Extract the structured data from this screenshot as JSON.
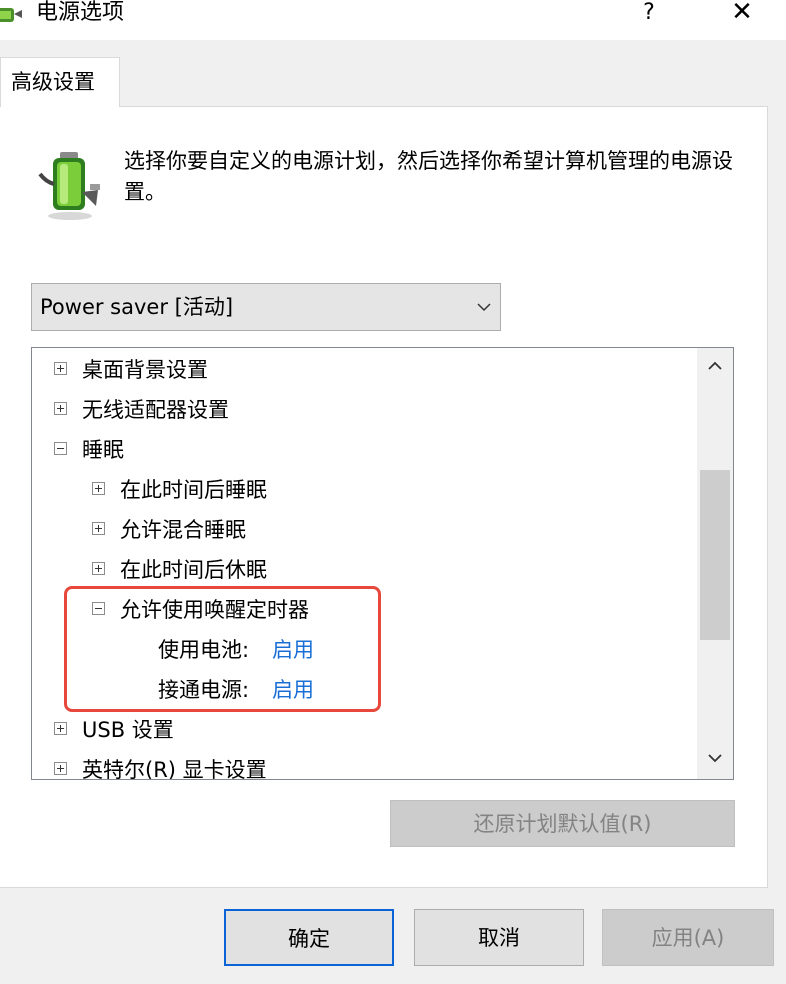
{
  "window": {
    "title": "电源选项",
    "help_glyph": "?",
    "close_glyph": "✕"
  },
  "tab": {
    "label": "高级设置"
  },
  "description": "选择你要自定义的电源计划，然后选择你希望计算机管理的电源设置。",
  "plan_select": {
    "selected": "Power saver [活动]"
  },
  "tree": {
    "items": [
      {
        "label": "桌面背景设置",
        "state": "collapsed"
      },
      {
        "label": "无线适配器设置",
        "state": "collapsed"
      },
      {
        "label": "睡眠",
        "state": "expanded"
      },
      {
        "label": "在此时间后睡眠",
        "state": "collapsed"
      },
      {
        "label": "允许混合睡眠",
        "state": "collapsed"
      },
      {
        "label": "在此时间后休眠",
        "state": "collapsed"
      },
      {
        "label": "允许使用唤醒定时器",
        "state": "expanded"
      },
      {
        "label": "USB 设置",
        "state": "collapsed"
      },
      {
        "label": "英特尔(R) 显卡设置",
        "state": "collapsed"
      }
    ],
    "battery": {
      "label": "使用电池:",
      "value": "启用"
    },
    "plugged_in": {
      "label": "接通电源:",
      "value": "启用"
    }
  },
  "buttons": {
    "restore": "还原计划默认值(R)",
    "ok": "确定",
    "cancel": "取消",
    "apply": "应用(A)"
  },
  "colors": {
    "highlight_border": "#e8473b",
    "link": "#1a6fd6",
    "focus_border": "#0a64d6"
  },
  "icons": [
    "power-options-icon",
    "battery-plug-icon",
    "chevron-down-icon",
    "scroll-up-icon",
    "scroll-down-icon"
  ]
}
